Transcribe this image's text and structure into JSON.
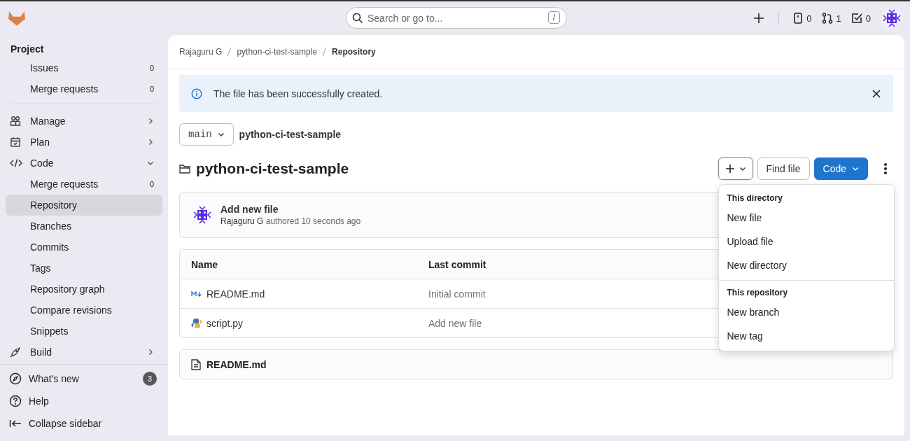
{
  "top_bar": {
    "search": {
      "placeholder": "Search or go to...",
      "shortcut": "/"
    },
    "counters": [
      {
        "kind": "issues",
        "count": "0"
      },
      {
        "kind": "merge_requests",
        "count": "1"
      },
      {
        "kind": "todos",
        "count": "0"
      }
    ]
  },
  "sidebar": {
    "title": "Project",
    "sections": [
      [
        {
          "kind": "sub",
          "label": "Issues",
          "count": "0",
          "selected": false
        },
        {
          "kind": "sub",
          "label": "Merge requests",
          "count": "0",
          "selected": false
        }
      ],
      [
        {
          "kind": "group",
          "label": "Manage",
          "expanded": false
        },
        {
          "kind": "group",
          "label": "Plan",
          "expanded": false
        },
        {
          "kind": "group",
          "label": "Code",
          "expanded": true
        },
        {
          "kind": "sub",
          "label": "Merge requests",
          "count": "0",
          "selected": false
        },
        {
          "kind": "sub",
          "label": "Repository",
          "selected": true
        },
        {
          "kind": "sub",
          "label": "Branches",
          "selected": false
        },
        {
          "kind": "sub",
          "label": "Commits",
          "selected": false
        },
        {
          "kind": "sub",
          "label": "Tags",
          "selected": false
        },
        {
          "kind": "sub",
          "label": "Repository graph",
          "selected": false
        },
        {
          "kind": "sub",
          "label": "Compare revisions",
          "selected": false
        },
        {
          "kind": "sub",
          "label": "Snippets",
          "selected": false
        },
        {
          "kind": "group",
          "label": "Build",
          "expanded": false
        }
      ]
    ],
    "footer": [
      {
        "kind": "whats_new",
        "label": "What's new",
        "badge": "3"
      },
      {
        "kind": "help",
        "label": "Help"
      },
      {
        "kind": "collapse",
        "label": "Collapse sidebar"
      }
    ]
  },
  "breadcrumbs": [
    {
      "label": "Rajaguru G",
      "selected": false
    },
    {
      "label": "python-ci-test-sample",
      "selected": false
    },
    {
      "label": "Repository",
      "selected": true
    }
  ],
  "alert": {
    "message": "The file has been successfully created."
  },
  "branch": "main",
  "path": "python-ci-test-sample",
  "title": "python-ci-test-sample",
  "actions": {
    "add_expanded": true,
    "find_file": "Find file",
    "code": "Code"
  },
  "dropdown": [
    {
      "title": "This directory",
      "items": [
        "New file",
        "Upload file",
        "New directory"
      ]
    },
    {
      "title": "This repository",
      "items": [
        "New branch",
        "New tag"
      ]
    }
  ],
  "last_commit": {
    "title": "Add new file",
    "author": "Rajaguru G",
    "meta": "authored 10 seconds ago"
  },
  "table": {
    "columns": [
      "Name",
      "Last commit"
    ],
    "rows": [
      {
        "kind": "markdown",
        "name": "README.md",
        "commit": "Initial commit"
      },
      {
        "kind": "python",
        "name": "script.py",
        "commit": "Add new file"
      }
    ]
  },
  "readme": {
    "title": "README.md"
  }
}
